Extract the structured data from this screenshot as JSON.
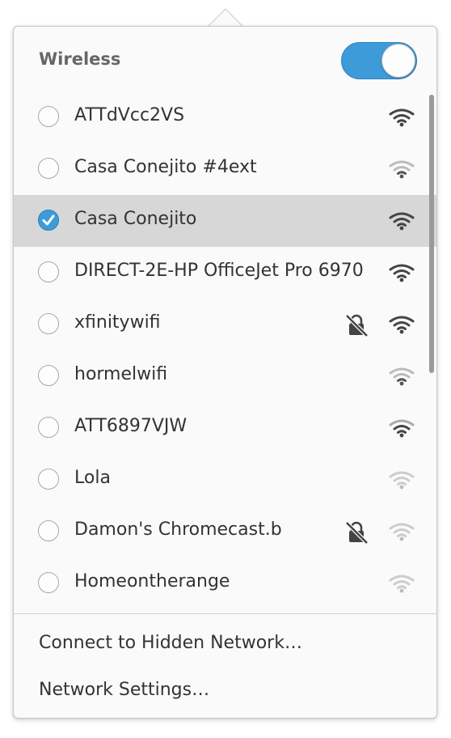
{
  "header": {
    "title": "Wireless",
    "toggle_on": true
  },
  "networks": [
    {
      "ssid": "ATTdVcc2VS",
      "selected": false,
      "signal": "strong",
      "locked": false
    },
    {
      "ssid": "Casa Conejito #4ext",
      "selected": false,
      "signal": "weak",
      "locked": false
    },
    {
      "ssid": "Casa Conejito",
      "selected": true,
      "signal": "strong",
      "locked": false
    },
    {
      "ssid": "DIRECT-2E-HP OfficeJet Pro 6970",
      "selected": false,
      "signal": "strong",
      "locked": false
    },
    {
      "ssid": "xfinitywifi",
      "selected": false,
      "signal": "strong",
      "locked": true
    },
    {
      "ssid": "hormelwifi",
      "selected": false,
      "signal": "weak",
      "locked": false
    },
    {
      "ssid": "ATT6897VJW",
      "selected": false,
      "signal": "medium",
      "locked": false
    },
    {
      "ssid": "Lola",
      "selected": false,
      "signal": "faint",
      "locked": false
    },
    {
      "ssid": "Damon's Chromecast.b",
      "selected": false,
      "signal": "faint",
      "locked": true
    },
    {
      "ssid": "Homeontherange",
      "selected": false,
      "signal": "faint",
      "locked": false
    }
  ],
  "menu": {
    "hidden_network": "Connect to Hidden Network…",
    "settings": "Network Settings…"
  },
  "colors": {
    "accent": "#3d9bda",
    "selected_row": "#d7d7d7"
  },
  "icons": {
    "secure": "lock-icon",
    "insecure": "lock-open-slashed-icon",
    "signal": "wifi-signal-icon",
    "check": "checkmark-icon"
  }
}
